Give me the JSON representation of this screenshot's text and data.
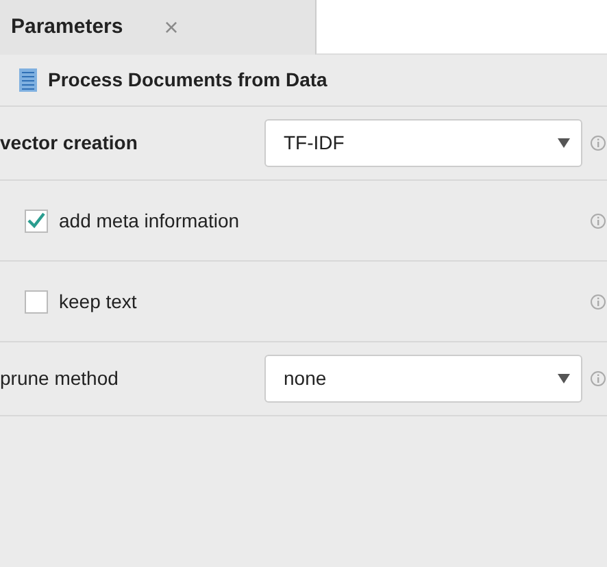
{
  "tabs": [
    {
      "label": "Parameters",
      "close": "×",
      "selected": true
    }
  ],
  "operator": {
    "title": "Process Documents from Data"
  },
  "parameters": [
    {
      "kind": "select",
      "label": "vector creation",
      "value": "TF-IDF",
      "bold": true
    },
    {
      "kind": "checkbox",
      "label": "add meta information",
      "checked": true
    },
    {
      "kind": "checkbox",
      "label": "keep text",
      "checked": false
    },
    {
      "kind": "select",
      "label": "prune method",
      "value": "none",
      "bold": false
    }
  ]
}
